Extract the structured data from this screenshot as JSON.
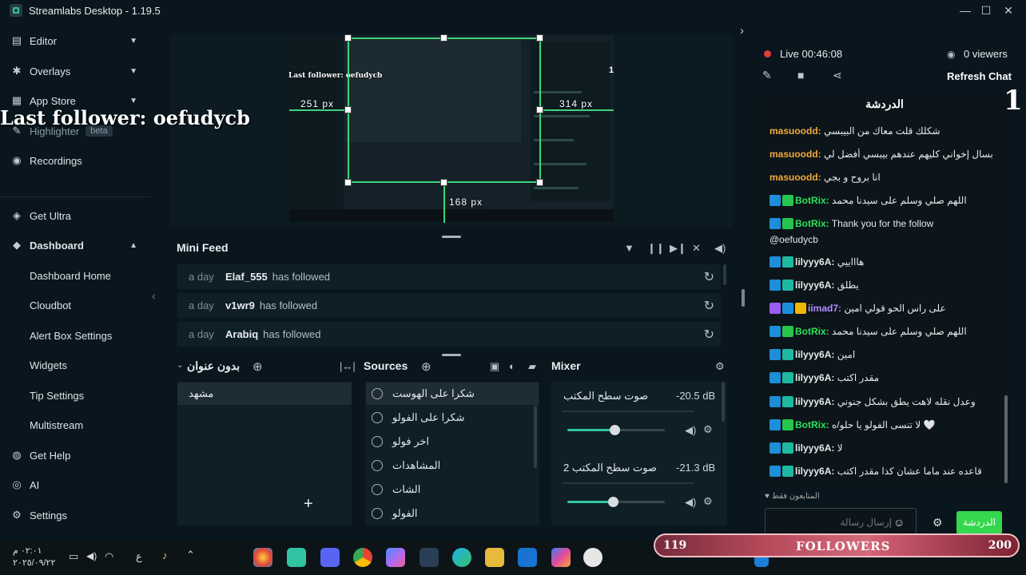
{
  "window": {
    "title": "Streamlabs Desktop - 1.19.5"
  },
  "sidebar": {
    "items": [
      {
        "label": "Editor",
        "icon": "editor-icon"
      },
      {
        "label": "Overlays",
        "icon": "overlays-icon"
      },
      {
        "label": "App Store",
        "icon": "app-store-icon"
      },
      {
        "label": "Highlighter",
        "badge": "beta",
        "icon": "highlighter-icon"
      },
      {
        "label": "Recordings",
        "icon": "recordings-icon"
      },
      {
        "label": "Get Ultra",
        "icon": "ultra-icon"
      },
      {
        "label": "Dashboard",
        "icon": "dashboard-icon"
      },
      {
        "label": "Dashboard Home"
      },
      {
        "label": "Cloudbot"
      },
      {
        "label": "Alert Box Settings"
      },
      {
        "label": "Widgets"
      },
      {
        "label": "Tip Settings"
      },
      {
        "label": "Multistream"
      },
      {
        "label": "Get Help",
        "icon": "help-icon"
      },
      {
        "label": "AI",
        "icon": "ai-icon"
      },
      {
        "label": "Settings",
        "icon": "settings-icon"
      }
    ]
  },
  "overlay": {
    "last_follower": "Last follower: oefudycb"
  },
  "preview": {
    "left_px": "251 px",
    "right_px": "314 px",
    "bottom_px": "168 px",
    "corner": "1"
  },
  "minifeed": {
    "title": "Mini Feed",
    "rows": [
      {
        "time": "a day",
        "name": "Elaf_555",
        "action": "has followed"
      },
      {
        "time": "a day",
        "name": "v1wr9",
        "action": "has followed"
      },
      {
        "time": "a day",
        "name": "Arabiq",
        "action": "has followed"
      }
    ]
  },
  "scenes": {
    "title": "بدون عنوان",
    "items": [
      "مشهد"
    ]
  },
  "sources": {
    "title": "Sources",
    "items": [
      "شكرا على الهوست",
      "شكرا على الفولو",
      "اخر فولو",
      "المشاهدات",
      "الشات",
      "الفولو"
    ]
  },
  "mixer": {
    "title": "Mixer",
    "channels": [
      {
        "name": "صوت سطح المكتب",
        "db": "-20.5 dB",
        "level": 0.48
      },
      {
        "name": "صوت سطح المكتب 2",
        "db": "-21.3 dB",
        "level": 0.47
      }
    ]
  },
  "chat_panel": {
    "live": "Live 00:46:08",
    "viewers": "0 viewers",
    "refresh": "Refresh Chat",
    "header": "الدردشة",
    "corner": "1",
    "messages": [
      {
        "user": "masuoodd:",
        "color": "#f2a93b",
        "text": "شكلك قلت معاك من البيبسي",
        "badges": []
      },
      {
        "user": "masuoodd:",
        "color": "#f2a93b",
        "text": "انا بسال إخواني كليهم عندهم بيبسي أفضل لي",
        "badges": []
      },
      {
        "user": "masuoodd:",
        "color": "#f2a93b",
        "text": "انا بروح و بجي",
        "badges": []
      },
      {
        "user": "BotRix:",
        "color": "#2ee15a",
        "text": "اللهم صلي وسلم على سيدنا محمد",
        "badges": [
          "mod",
          "verified"
        ]
      },
      {
        "user": "BotRix:",
        "color": "#2ee15a",
        "text": "Thank you for the follow",
        "badges": [
          "mod",
          "verified"
        ]
      },
      {
        "user": "",
        "color": "#e8e8e8",
        "text": "@oefudycb",
        "badges": []
      },
      {
        "user": "lilyyy6A:",
        "color": "#e8e8e8",
        "text": "هاااييي",
        "badges": [
          "mod",
          "sub"
        ]
      },
      {
        "user": "lilyyy6A:",
        "color": "#e8e8e8",
        "text": "يطلق",
        "badges": [
          "mod",
          "sub"
        ]
      },
      {
        "user": "iimad7:",
        "color": "#b48cff",
        "text": "على راس الحو قولي امين",
        "badges": [
          "mic",
          "mod",
          "crown"
        ]
      },
      {
        "user": "BotRix:",
        "color": "#2ee15a",
        "text": "اللهم صلي وسلم على سيدنا محمد",
        "badges": [
          "mod",
          "verified"
        ]
      },
      {
        "user": "lilyyy6A:",
        "color": "#e8e8e8",
        "text": "امين",
        "badges": [
          "mod",
          "sub"
        ]
      },
      {
        "user": "lilyyy6A:",
        "color": "#e8e8e8",
        "text": "مقدر اكتب",
        "badges": [
          "mod",
          "sub"
        ]
      },
      {
        "user": "lilyyy6A:",
        "color": "#e8e8e8",
        "text": "وعدل نقله لاهت يطق بشكل جنوني",
        "badges": [
          "mod",
          "sub"
        ]
      },
      {
        "user": "BotRix:",
        "color": "#2ee15a",
        "text": "لا تنسى الفولو يا حلو/ه 🤍",
        "badges": [
          "mod",
          "verified"
        ]
      },
      {
        "user": "lilyyy6A:",
        "color": "#e8e8e8",
        "text": "لا",
        "badges": [
          "mod",
          "sub"
        ]
      },
      {
        "user": "lilyyy6A:",
        "color": "#e8e8e8",
        "text": "قاعده عند ماما عشان كذا مقدر اكتب",
        "badges": [
          "mod",
          "sub"
        ]
      }
    ],
    "followers_only": "المتابعون فقط",
    "input_placeholder": "إرسال رسالة",
    "send_label": "الدردشة"
  },
  "followers_widget": {
    "current": "119",
    "label": "FOLLOWERS",
    "goal": "200",
    "progress": 0.595
  },
  "taskbar": {
    "time": "٠٢:٠١ م",
    "date": "٢٠٢٥/٠٩/٢٢",
    "lang": "ع"
  },
  "colors": {
    "accent": "#31c3a2",
    "selection": "#3fd47a",
    "send": "#35d84c",
    "background": "#09161d"
  }
}
